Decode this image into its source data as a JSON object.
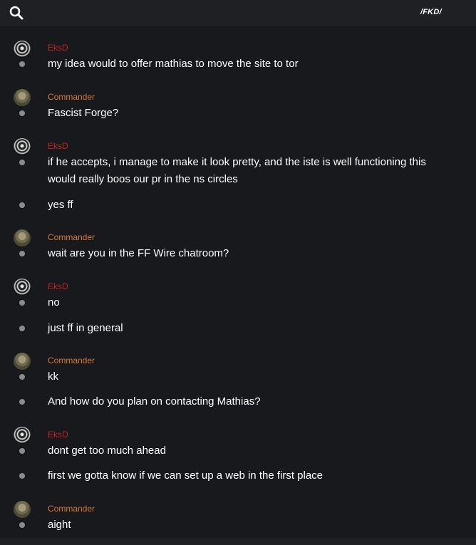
{
  "header": {
    "search_icon": "search-icon",
    "room_name": "/FKD/"
  },
  "colors": {
    "eksd": "#c0261e",
    "commander": "#d77a2e",
    "background": "#18191c"
  },
  "groups": [
    {
      "author": "EksD",
      "messages": [
        "my idea would to offer mathias to move the site to tor"
      ]
    },
    {
      "author": "Commander",
      "messages": [
        "Fascist Forge?"
      ]
    },
    {
      "author": "EksD",
      "messages": [
        "if he accepts, i manage to make it look pretty, and the iste is well functioning this would really boos our pr in the ns  circles",
        "yes ff"
      ]
    },
    {
      "author": "Commander",
      "messages": [
        "wait are you in the FF Wire chatroom?"
      ]
    },
    {
      "author": "EksD",
      "messages": [
        "no",
        "just ff in general"
      ]
    },
    {
      "author": "Commander",
      "messages": [
        "kk",
        "And how do you plan on contacting Mathias?"
      ]
    },
    {
      "author": "EksD",
      "messages": [
        "dont get too much ahead",
        "first we gotta know if we can set up a web in the first place"
      ]
    },
    {
      "author": "Commander",
      "messages": [
        "aight"
      ]
    }
  ]
}
